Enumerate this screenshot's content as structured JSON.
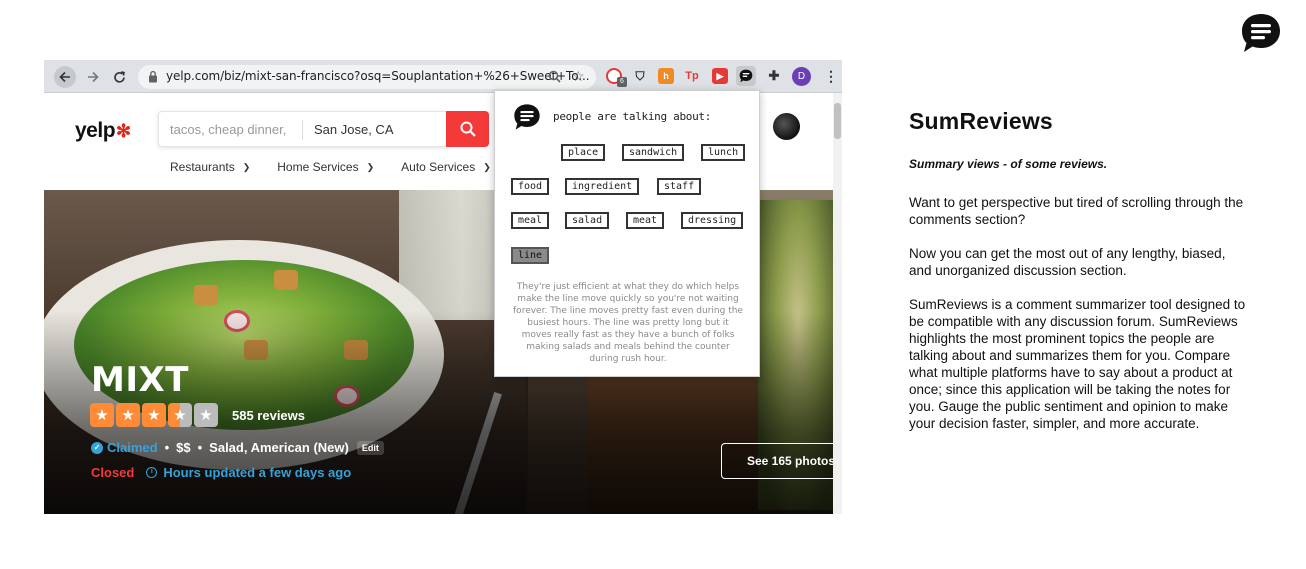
{
  "browser": {
    "url": "yelp.com/biz/mixt-san-francisco?osq=Souplantation+%26+Sweet+To...",
    "extension_badge": "6",
    "profile_initial": "D"
  },
  "yelp": {
    "logo_text": "yelp",
    "search_find_placeholder": "tacos, cheap dinner, I",
    "search_near_value": "San Jose, CA",
    "categories": [
      {
        "label": "Restaurants"
      },
      {
        "label": "Home Services"
      },
      {
        "label": "Auto Services"
      }
    ],
    "business": {
      "name": "MIXT",
      "rating": 3.5,
      "review_count": "585 reviews",
      "claimed": "Claimed",
      "price": "$$",
      "categories": "Salad, American (New)",
      "edit": "Edit",
      "status": "Closed",
      "hours": "Hours updated a few days ago",
      "photos_button": "See 165 photos"
    }
  },
  "popup": {
    "title": "people are talking about:",
    "tags": [
      "place",
      "sandwich",
      "lunch",
      "food",
      "ingredient",
      "staff",
      "meal",
      "salad",
      "meat",
      "dressing",
      "line"
    ],
    "active_tag": "line",
    "summary": "They're just efficient at what they do which helps make the line move quickly so you're not waiting forever. The line moves pretty fast even during the busiest hours. The line was pretty long but it moves really fast as they have a bunch of folks making salads and meals behind the counter during rush hour."
  },
  "side": {
    "title": "SumReviews",
    "subtitle": "Summary views - of some reviews.",
    "paragraph1": "Want to get perspective but tired of scrolling through the comments section?",
    "paragraph2": "Now you can get the most out of any lengthy, biased, and unorganized discussion section.",
    "paragraph3": "SumReviews is a comment summarizer tool designed to be compatible with any discussion forum. SumReviews highlights the most prominent topics the people are talking about and summarizes them for you. Compare what multiple platforms have to say about a product at once; since this application will be taking the notes for you. Gauge the public sentiment and opinion to make your decision faster, simpler, and more accurate."
  },
  "colors": {
    "yelp_red": "#f43939",
    "claimed_blue": "#35a3d9",
    "star_orange": "#fe8b38",
    "star_empty": "#bbbbbb"
  }
}
